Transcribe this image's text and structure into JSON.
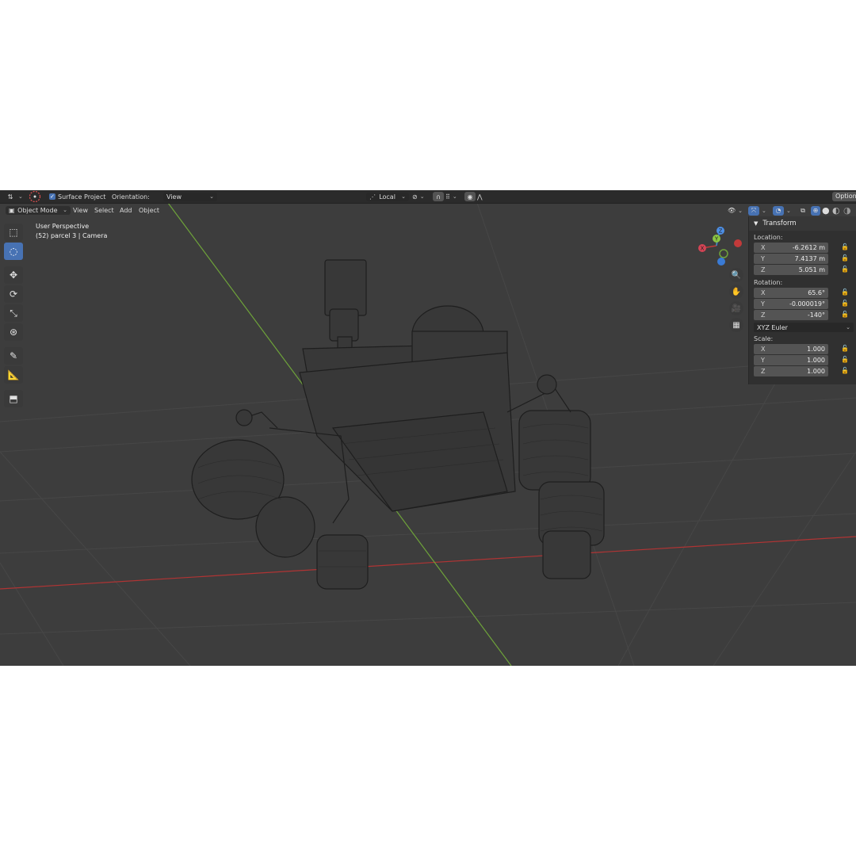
{
  "topbar": {
    "surface_project": "Surface Project",
    "orientation_label": "Orientation:",
    "orientation_value": "View",
    "pivot_value": "Local",
    "options_label": "Options"
  },
  "header": {
    "mode": "Object Mode",
    "menus": [
      "View",
      "Select",
      "Add",
      "Object"
    ]
  },
  "viewport": {
    "perspective": "User Perspective",
    "object_info": "(52) parcel 3 | Camera"
  },
  "gizmo": {
    "x": "X",
    "y": "Y",
    "z": "Z"
  },
  "sidebar": {
    "panel_title": "Transform",
    "location_label": "Location:",
    "location": [
      {
        "axis": "X",
        "value": "-6.2612 m"
      },
      {
        "axis": "Y",
        "value": "7.4137 m"
      },
      {
        "axis": "Z",
        "value": "5.051 m"
      }
    ],
    "rotation_label": "Rotation:",
    "rotation": [
      {
        "axis": "X",
        "value": "65.6°"
      },
      {
        "axis": "Y",
        "value": "-0.000019°"
      },
      {
        "axis": "Z",
        "value": "-140°"
      }
    ],
    "rotation_mode": "XYZ Euler",
    "scale_label": "Scale:",
    "scale": [
      {
        "axis": "X",
        "value": "1.000"
      },
      {
        "axis": "Y",
        "value": "1.000"
      },
      {
        "axis": "Z",
        "value": "1.000"
      }
    ]
  },
  "colors": {
    "accent": "#4772b3",
    "viewport": "#3d3d3d",
    "x_axis": "#c23a3a",
    "y_axis": "#6fa33a",
    "z_axis": "#3a7bd5"
  }
}
